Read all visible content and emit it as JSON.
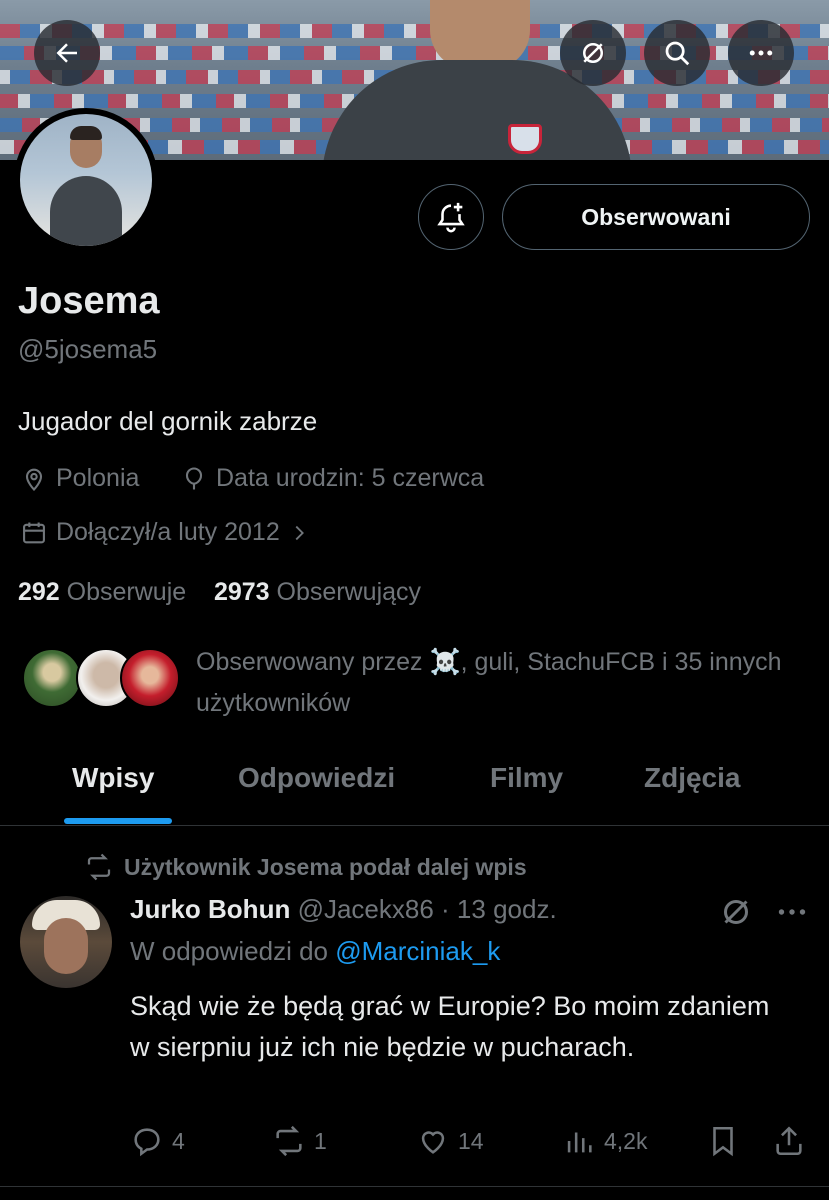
{
  "banner": {
    "back_icon": "arrow-left-icon",
    "grok_icon": "grok-icon",
    "search_icon": "search-icon",
    "more_icon": "more-horizontal-icon"
  },
  "profile": {
    "name": "Josema",
    "handle": "@5josema5",
    "bio": "Jugador del gornik zabrze",
    "location": "Polonia",
    "birthday": "Data urodzin: 5 czerwca",
    "joined": "Dołączył/a luty 2012",
    "follow_button": "Obserwowani",
    "following_count": "292",
    "following_label": "Obserwuje",
    "followers_count": "2973",
    "followers_label": "Obserwujący",
    "followed_by_prefix": "Obserwowany przez",
    "followed_by_emoji": "☠️",
    "followed_by_rest": ", guli, StachuFCB i 35 innych użytkowników"
  },
  "tabs": [
    {
      "label": "Wpisy",
      "active": true
    },
    {
      "label": "Odpowiedzi",
      "active": false
    },
    {
      "label": "Filmy",
      "active": false
    },
    {
      "label": "Zdjęcia",
      "active": false
    }
  ],
  "post": {
    "repost_label": "Użytkownik Josema podał dalej wpis",
    "author_name": "Jurko Bohun",
    "author_handle": "@Jacekx86",
    "time": "· 13 godz.",
    "reply_prefix": "W odpowiedzi do",
    "reply_to": "@Marciniak_k",
    "text": "Skąd wie że będą grać w Europie? Bo moim zdaniem w sierpniu już ich nie będzie w pucharach.",
    "replies": "4",
    "reposts": "1",
    "likes": "14",
    "views": "4,2k"
  },
  "colors": {
    "accent": "#1d9bf0",
    "muted": "#71767b",
    "text": "#e7e9ea",
    "background": "#000000"
  }
}
